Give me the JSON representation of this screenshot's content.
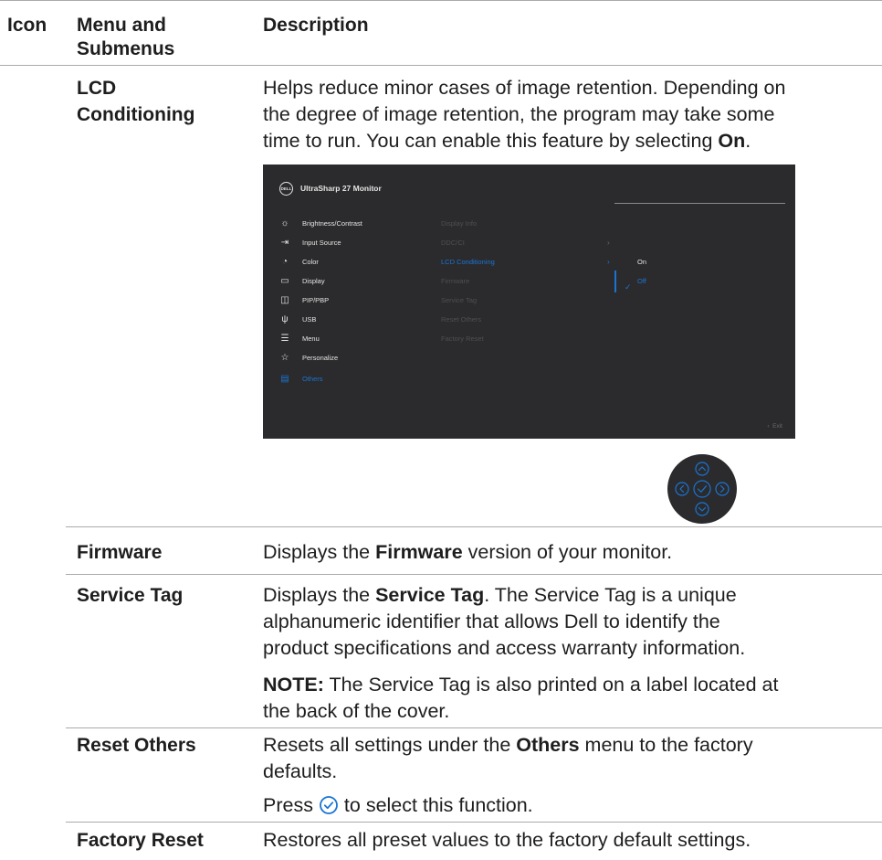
{
  "header": {
    "icon": "Icon",
    "menu": "Menu and",
    "menu2": "Submenus",
    "description": "Description"
  },
  "lcd": {
    "name1": "LCD",
    "name2": "Conditioning",
    "line1": "Helps reduce minor cases of image retention. Depending on",
    "line2": "the degree of image retention, the program may take some",
    "line3a": "time to run. You can enable this feature by selecting ",
    "line3b": "On",
    "line3c": "."
  },
  "osd": {
    "logo": "DELL",
    "title": "UltraSharp 27 Monitor",
    "menu_items": [
      {
        "icon": "brightness-icon",
        "label": "Brightness/Contrast"
      },
      {
        "icon": "input-source-icon",
        "label": "Input Source"
      },
      {
        "icon": "color-icon",
        "label": "Color"
      },
      {
        "icon": "display-icon",
        "label": "Display"
      },
      {
        "icon": "pip-pbp-icon",
        "label": "PIP/PBP"
      },
      {
        "icon": "usb-icon",
        "label": "USB"
      },
      {
        "icon": "menu-icon",
        "label": "Menu"
      },
      {
        "icon": "star-icon",
        "label": "Personalize"
      },
      {
        "icon": "others-icon",
        "label": "Others"
      }
    ],
    "sub_items": [
      "Display Info",
      "DDC/CI",
      "LCD Conditioning",
      "Firmware",
      "Service Tag",
      "Reset Others",
      "Factory Reset"
    ],
    "options": [
      "On",
      "Off"
    ],
    "exit": "Exit",
    "accent": "#1a74d2",
    "background": "#2b2b2d"
  },
  "firmware": {
    "name": "Firmware",
    "d1": "Displays the ",
    "d2": "Firmware",
    "d3": " version of your monitor."
  },
  "service_tag": {
    "name": "Service Tag",
    "d1": "Displays the ",
    "d2": "Service Tag",
    "d3": ". The Service Tag is a unique",
    "line2": "alphanumeric identifier that allows Dell to identify the",
    "line3": "product specifications and access warranty information.",
    "note_label": "NOTE:",
    "note1": " The Service Tag is also printed on a label located at",
    "note2": "the back of the cover."
  },
  "reset_others": {
    "name": "Reset Others",
    "d1": "Resets all settings under the ",
    "d2": "Others",
    "d3": " menu to the factory",
    "line2": "defaults.",
    "press1": "Press ",
    "press2": " to select this function."
  },
  "factory_reset": {
    "name": "Factory Reset",
    "desc": "Restores all preset values to the factory default settings."
  }
}
